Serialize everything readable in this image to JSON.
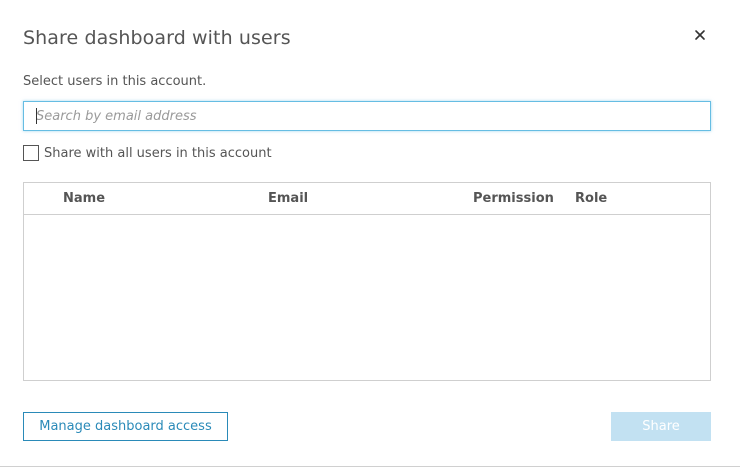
{
  "dialog": {
    "title": "Share dashboard with users",
    "close_icon": "close-icon",
    "subtitle": "Select users in this account.",
    "search": {
      "placeholder": "Search by email address",
      "value": ""
    },
    "share_all": {
      "label": "Share with all users in this account",
      "checked": false
    },
    "table": {
      "columns": [
        "Name",
        "Email",
        "Permission",
        "Role"
      ],
      "rows": []
    },
    "manage_label": "Manage dashboard access",
    "share_label": "Share",
    "share_enabled": false
  },
  "colors": {
    "accent": "#2a8ab8",
    "focus_border": "#66bde3",
    "share_disabled_bg": "#c2e1f2"
  }
}
